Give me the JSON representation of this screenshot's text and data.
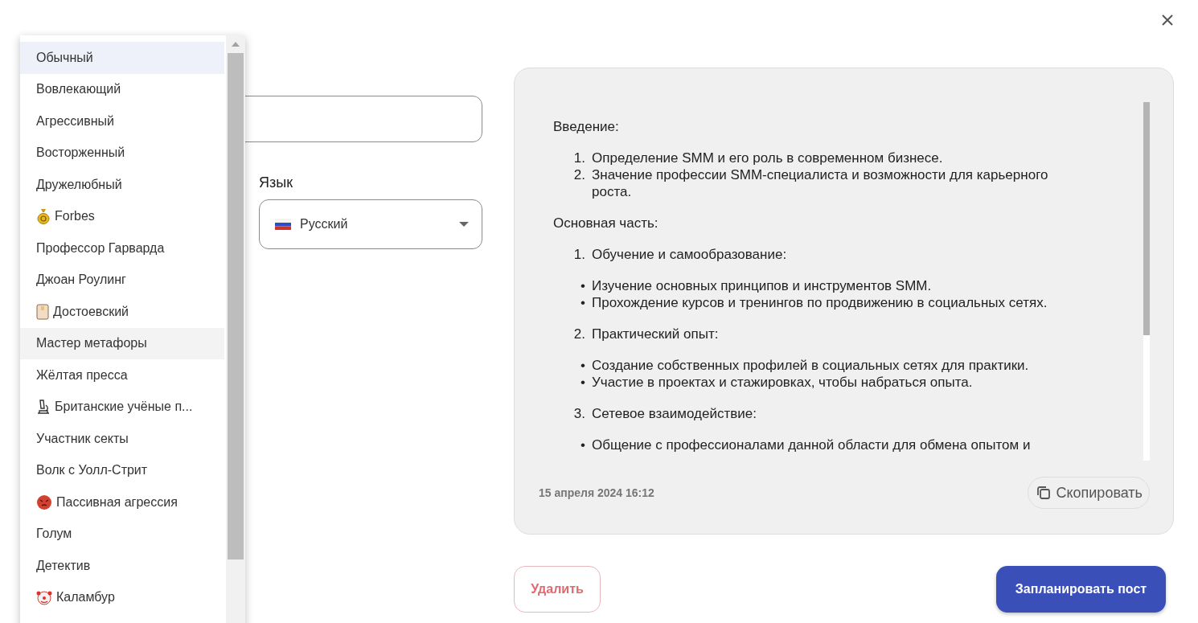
{
  "style_menu": {
    "items": [
      {
        "label": "Обычный",
        "kind": "plain",
        "selected": true,
        "hovered": false
      },
      {
        "label": "Вовлекающий",
        "kind": "plain",
        "selected": false,
        "hovered": false
      },
      {
        "label": "Агрессивный",
        "kind": "plain",
        "selected": false,
        "hovered": false
      },
      {
        "label": "Восторженный",
        "kind": "plain",
        "selected": false,
        "hovered": false
      },
      {
        "label": "Дружелюбный",
        "kind": "plain",
        "selected": false,
        "hovered": false
      },
      {
        "label": "Forbes",
        "kind": "money",
        "selected": false,
        "hovered": false
      },
      {
        "label": "Профессор Гарварда",
        "kind": "plain",
        "selected": false,
        "hovered": false
      },
      {
        "label": "Джоан Роулинг",
        "kind": "plain",
        "selected": false,
        "hovered": false
      },
      {
        "label": "Достоевский",
        "kind": "scroll",
        "selected": false,
        "hovered": false
      },
      {
        "label": "Мастер метафоры",
        "kind": "plain",
        "selected": false,
        "hovered": true
      },
      {
        "label": "Жёлтая пресса",
        "kind": "plain",
        "selected": false,
        "hovered": false
      },
      {
        "label": "Британские учёные п...",
        "kind": "microscope",
        "selected": false,
        "hovered": false
      },
      {
        "label": "Участник секты",
        "kind": "plain",
        "selected": false,
        "hovered": false
      },
      {
        "label": "Волк с Уолл-Стрит",
        "kind": "plain",
        "selected": false,
        "hovered": false
      },
      {
        "label": "Пассивная агрессия",
        "kind": "angry",
        "selected": false,
        "hovered": false
      },
      {
        "label": "Голум",
        "kind": "plain",
        "selected": false,
        "hovered": false
      },
      {
        "label": "Детектив",
        "kind": "plain",
        "selected": false,
        "hovered": false
      },
      {
        "label": "Каламбур",
        "kind": "clown",
        "selected": false,
        "hovered": false
      }
    ]
  },
  "language": {
    "label": "Язык",
    "value": "Русский"
  },
  "post": {
    "blocks": [
      {
        "kind": "paragraph",
        "text": "Введение:"
      },
      {
        "kind": "numbered",
        "items": [
          {
            "marker": "1.",
            "text": "Определение SMM и его роль в современном бизнесе."
          },
          {
            "marker": "2.",
            "text": "Значение профессии SMM-специалиста и возможности для карьерного роста."
          }
        ]
      },
      {
        "kind": "paragraph",
        "text": "Основная часть:"
      },
      {
        "kind": "numbered",
        "items": [
          {
            "marker": "1.",
            "text": "Обучение и самообразование:"
          }
        ]
      },
      {
        "kind": "bulleted",
        "items": [
          {
            "marker": "•",
            "text": "Изучение основных принципов и инструментов SMM."
          },
          {
            "marker": "•",
            "text": "Прохождение курсов и тренингов по продвижению в социальных сетях."
          }
        ]
      },
      {
        "kind": "numbered",
        "items": [
          {
            "marker": "2.",
            "text": "Практический опыт:"
          }
        ]
      },
      {
        "kind": "bulleted",
        "items": [
          {
            "marker": "•",
            "text": "Создание собственных профилей в социальных сетях для практики."
          },
          {
            "marker": "•",
            "text": "Участие в проектах и стажировках, чтобы набраться опыта."
          }
        ]
      },
      {
        "kind": "numbered",
        "items": [
          {
            "marker": "3.",
            "text": "Сетевое взаимодействие:"
          }
        ]
      },
      {
        "kind": "bulleted",
        "items": [
          {
            "marker": "•",
            "text": "Общение с профессионалами данной области для обмена опытом и"
          }
        ]
      }
    ],
    "date": "15 апреля 2024 16:12",
    "copy_button": "Скопировать"
  },
  "buttons": {
    "delete": "Удалить",
    "schedule": "Запланировать пост"
  }
}
